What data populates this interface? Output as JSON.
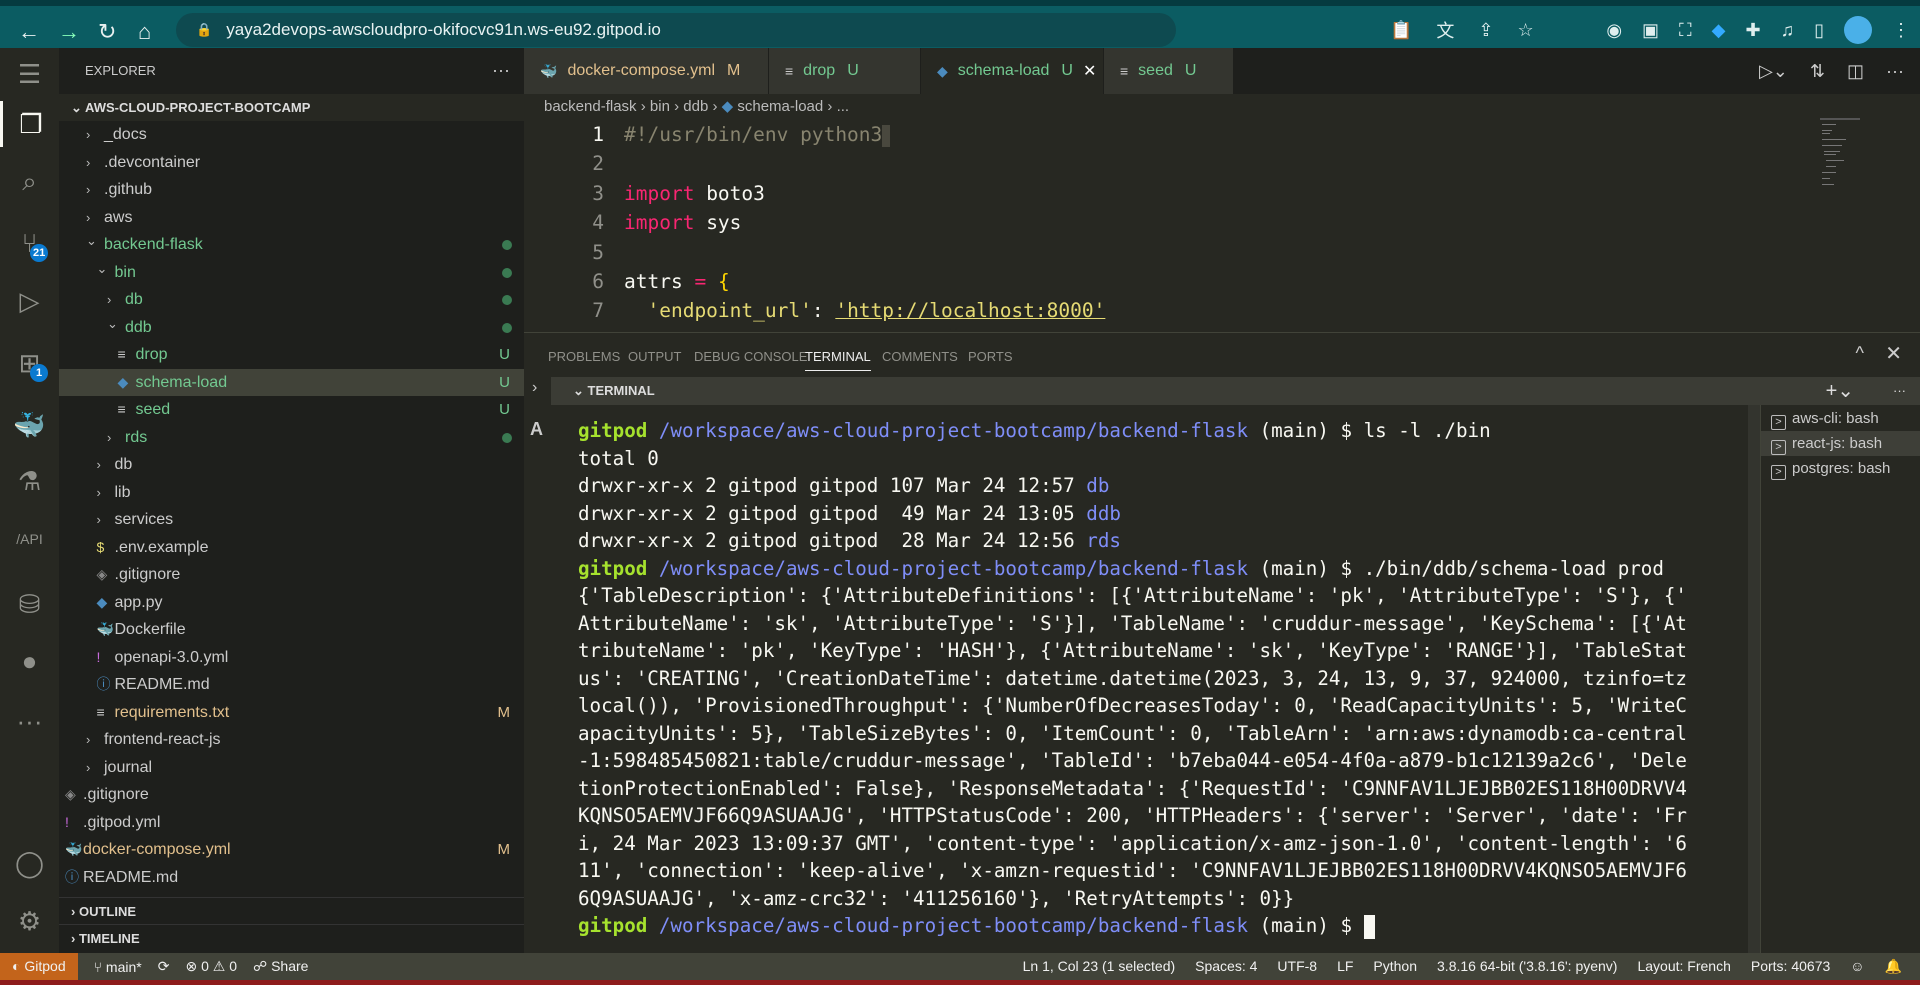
{
  "browser": {
    "url": "yaya2devops-awscloudpro-okifocvc91n.ws-eu92.gitpod.io"
  },
  "colors": {
    "editor_bg": "#272822",
    "sidebar_bg": "#1e1f1c",
    "status_bg": "#414339",
    "gitpod_orange": "#c3641b",
    "untracked_green": "#73c991",
    "modified_yellow": "#e2c08d",
    "prompt_green": "#a6e22e",
    "path_blue": "#7f8ef8"
  },
  "activity": {
    "source_control_badge": "21",
    "extensions_badge": "1"
  },
  "sidebar": {
    "title": "EXPLORER",
    "more": "···",
    "root": "AWS-CLOUD-PROJECT-BOOTCAMP",
    "items": [
      {
        "label": "_docs",
        "type": "folder",
        "level": 0,
        "open": false
      },
      {
        "label": ".devcontainer",
        "type": "folder",
        "level": 0,
        "open": false
      },
      {
        "label": ".github",
        "type": "folder",
        "level": 0,
        "open": false
      },
      {
        "label": "aws",
        "type": "folder",
        "level": 0,
        "open": false
      },
      {
        "label": "backend-flask",
        "type": "folder",
        "level": 0,
        "open": true,
        "status": "dot"
      },
      {
        "label": "bin",
        "type": "folder",
        "level": 1,
        "open": true,
        "status": "dot"
      },
      {
        "label": "db",
        "type": "folder",
        "level": 2,
        "open": false,
        "status": "dot"
      },
      {
        "label": "ddb",
        "type": "folder",
        "level": 2,
        "open": true,
        "status": "dot"
      },
      {
        "label": "drop",
        "type": "file",
        "icon": "lines",
        "level": 3,
        "status": "U"
      },
      {
        "label": "schema-load",
        "type": "file",
        "icon": "python",
        "level": 3,
        "status": "U",
        "selected": true
      },
      {
        "label": "seed",
        "type": "file",
        "icon": "lines",
        "level": 3,
        "status": "U"
      },
      {
        "label": "rds",
        "type": "folder",
        "level": 2,
        "open": false,
        "status": "dot"
      },
      {
        "label": "db",
        "type": "folder",
        "level": 1,
        "open": false
      },
      {
        "label": "lib",
        "type": "folder",
        "level": 1,
        "open": false
      },
      {
        "label": "services",
        "type": "folder",
        "level": 1,
        "open": false
      },
      {
        "label": ".env.example",
        "type": "file",
        "icon": "dollar",
        "level": 1
      },
      {
        "label": ".gitignore",
        "type": "file",
        "icon": "git",
        "level": 1
      },
      {
        "label": "app.py",
        "type": "file",
        "icon": "python",
        "level": 1
      },
      {
        "label": "Dockerfile",
        "type": "file",
        "icon": "docker",
        "level": 1
      },
      {
        "label": "openapi-3.0.yml",
        "type": "file",
        "icon": "exclaim",
        "level": 1
      },
      {
        "label": "README.md",
        "type": "file",
        "icon": "info",
        "level": 1
      },
      {
        "label": "requirements.txt",
        "type": "file",
        "icon": "lines",
        "level": 1,
        "status": "M"
      },
      {
        "label": "frontend-react-js",
        "type": "folder",
        "level": 0,
        "open": false
      },
      {
        "label": "journal",
        "type": "folder",
        "level": 0,
        "open": false
      },
      {
        "label": ".gitignore",
        "type": "file",
        "icon": "git",
        "level": -1
      },
      {
        "label": ".gitpod.yml",
        "type": "file",
        "icon": "exclaim",
        "level": -1
      },
      {
        "label": "docker-compose.yml",
        "type": "file",
        "icon": "docker",
        "level": -1,
        "status": "M"
      },
      {
        "label": "README.md",
        "type": "file",
        "icon": "info",
        "level": -1
      }
    ],
    "sections": [
      "OUTLINE",
      "TIMELINE"
    ]
  },
  "tabs": [
    {
      "label": "docker-compose.yml",
      "status": "M",
      "icon": "docker"
    },
    {
      "label": "drop",
      "status": "U",
      "icon": "lines"
    },
    {
      "label": "schema-load",
      "status": "U",
      "icon": "python",
      "active": true
    },
    {
      "label": "seed",
      "status": "U",
      "icon": "lines"
    }
  ],
  "breadcrumb": [
    "backend-flask",
    "bin",
    "ddb",
    "schema-load",
    "..."
  ],
  "code": [
    {
      "n": "1",
      "html": [
        [
          "#!/usr/bin/env python3",
          "cm"
        ]
      ]
    },
    {
      "n": "2",
      "html": []
    },
    {
      "n": "3",
      "html": [
        [
          "import",
          "kw"
        ],
        [
          " boto3",
          ""
        ]
      ]
    },
    {
      "n": "4",
      "html": [
        [
          "import",
          "kw"
        ],
        [
          " sys",
          ""
        ]
      ]
    },
    {
      "n": "5",
      "html": []
    },
    {
      "n": "6",
      "html": [
        [
          "attrs ",
          ""
        ],
        [
          "=",
          "op"
        ],
        [
          " ",
          ""
        ],
        [
          "{",
          "br"
        ]
      ]
    },
    {
      "n": "7",
      "html": [
        [
          "  'endpoint_url'",
          "st"
        ],
        [
          ": ",
          ""
        ],
        [
          "'http://localhost:8000'",
          "st"
        ]
      ]
    }
  ],
  "panel": {
    "tabs": [
      "PROBLEMS",
      "OUTPUT",
      "DEBUG CONSOLE",
      "TERMINAL",
      "COMMENTS",
      "PORTS"
    ],
    "active": "TERMINAL",
    "section": "TERMINAL"
  },
  "terminal": {
    "prompt_user": "gitpod",
    "prompt_path": "/workspace/aws-cloud-project-bootcamp/backend-flask",
    "prompt_branch": " (main) $ ",
    "lines": [
      {
        "prompt": true,
        "cmd": "ls -l ./bin"
      },
      {
        "text": "total 0"
      },
      {
        "text": "drwxr-xr-x 2 gitpod gitpod 107 Mar 24 12:57 ",
        "dir": "db"
      },
      {
        "text": "drwxr-xr-x 2 gitpod gitpod  49 Mar 24 13:05 ",
        "dir": "ddb"
      },
      {
        "text": "drwxr-xr-x 2 gitpod gitpod  28 Mar 24 12:56 ",
        "dir": "rds"
      },
      {
        "prompt": true,
        "cmd": "./bin/ddb/schema-load prod"
      },
      {
        "text": "{'TableDescription': {'AttributeDefinitions': [{'AttributeName': 'pk', 'AttributeType': 'S'}, {'"
      },
      {
        "text": "AttributeName': 'sk', 'AttributeType': 'S'}], 'TableName': 'cruddur-message', 'KeySchema': [{'At"
      },
      {
        "text": "tributeName': 'pk', 'KeyType': 'HASH'}, {'AttributeName': 'sk', 'KeyType': 'RANGE'}], 'TableStat"
      },
      {
        "text": "us': 'CREATING', 'CreationDateTime': datetime.datetime(2023, 3, 24, 13, 9, 37, 924000, tzinfo=tz"
      },
      {
        "text": "local()), 'ProvisionedThroughput': {'NumberOfDecreasesToday': 0, 'ReadCapacityUnits': 5, 'WriteC"
      },
      {
        "text": "apacityUnits': 5}, 'TableSizeBytes': 0, 'ItemCount': 0, 'TableArn': 'arn:aws:dynamodb:ca-central"
      },
      {
        "text": "-1:598485450821:table/cruddur-message', 'TableId': 'b7eba044-e054-4f0a-a879-b1c12139a2c6', 'Dele"
      },
      {
        "text": "tionProtectionEnabled': False}, 'ResponseMetadata': {'RequestId': 'C9NNFAV1LJEJBB02ES118H00DRVV4"
      },
      {
        "text": "KQNSO5AEMVJF66Q9ASUAAJG', 'HTTPStatusCode': 200, 'HTTPHeaders': {'server': 'Server', 'date': 'Fr"
      },
      {
        "text": "i, 24 Mar 2023 13:09:37 GMT', 'content-type': 'application/x-amz-json-1.0', 'content-length': '6"
      },
      {
        "text": "11', 'connection': 'keep-alive', 'x-amzn-requestid': 'C9NNFAV1LJEJBB02ES118H00DRVV4KQNSO5AEMVJF6"
      },
      {
        "text": "6Q9ASUAAJG', 'x-amz-crc32': '411256160'}, 'RetryAttempts': 0}}"
      },
      {
        "prompt": true,
        "cmd": "",
        "cursor": true
      }
    ],
    "sessions": [
      {
        "label": "aws-cli: bash"
      },
      {
        "label": "react-js: bash",
        "selected": true
      },
      {
        "label": "postgres: bash"
      }
    ]
  },
  "status": {
    "gitpod": "Gitpod",
    "branch": "main*",
    "errors": "0",
    "warnings": "0",
    "share": "Share",
    "right": [
      "Ln 1, Col 23 (1 selected)",
      "Spaces: 4",
      "UTF-8",
      "LF",
      "Python",
      "3.8.16 64-bit ('3.8.16': pyenv)",
      "Layout: French",
      "Ports: 40673"
    ]
  }
}
